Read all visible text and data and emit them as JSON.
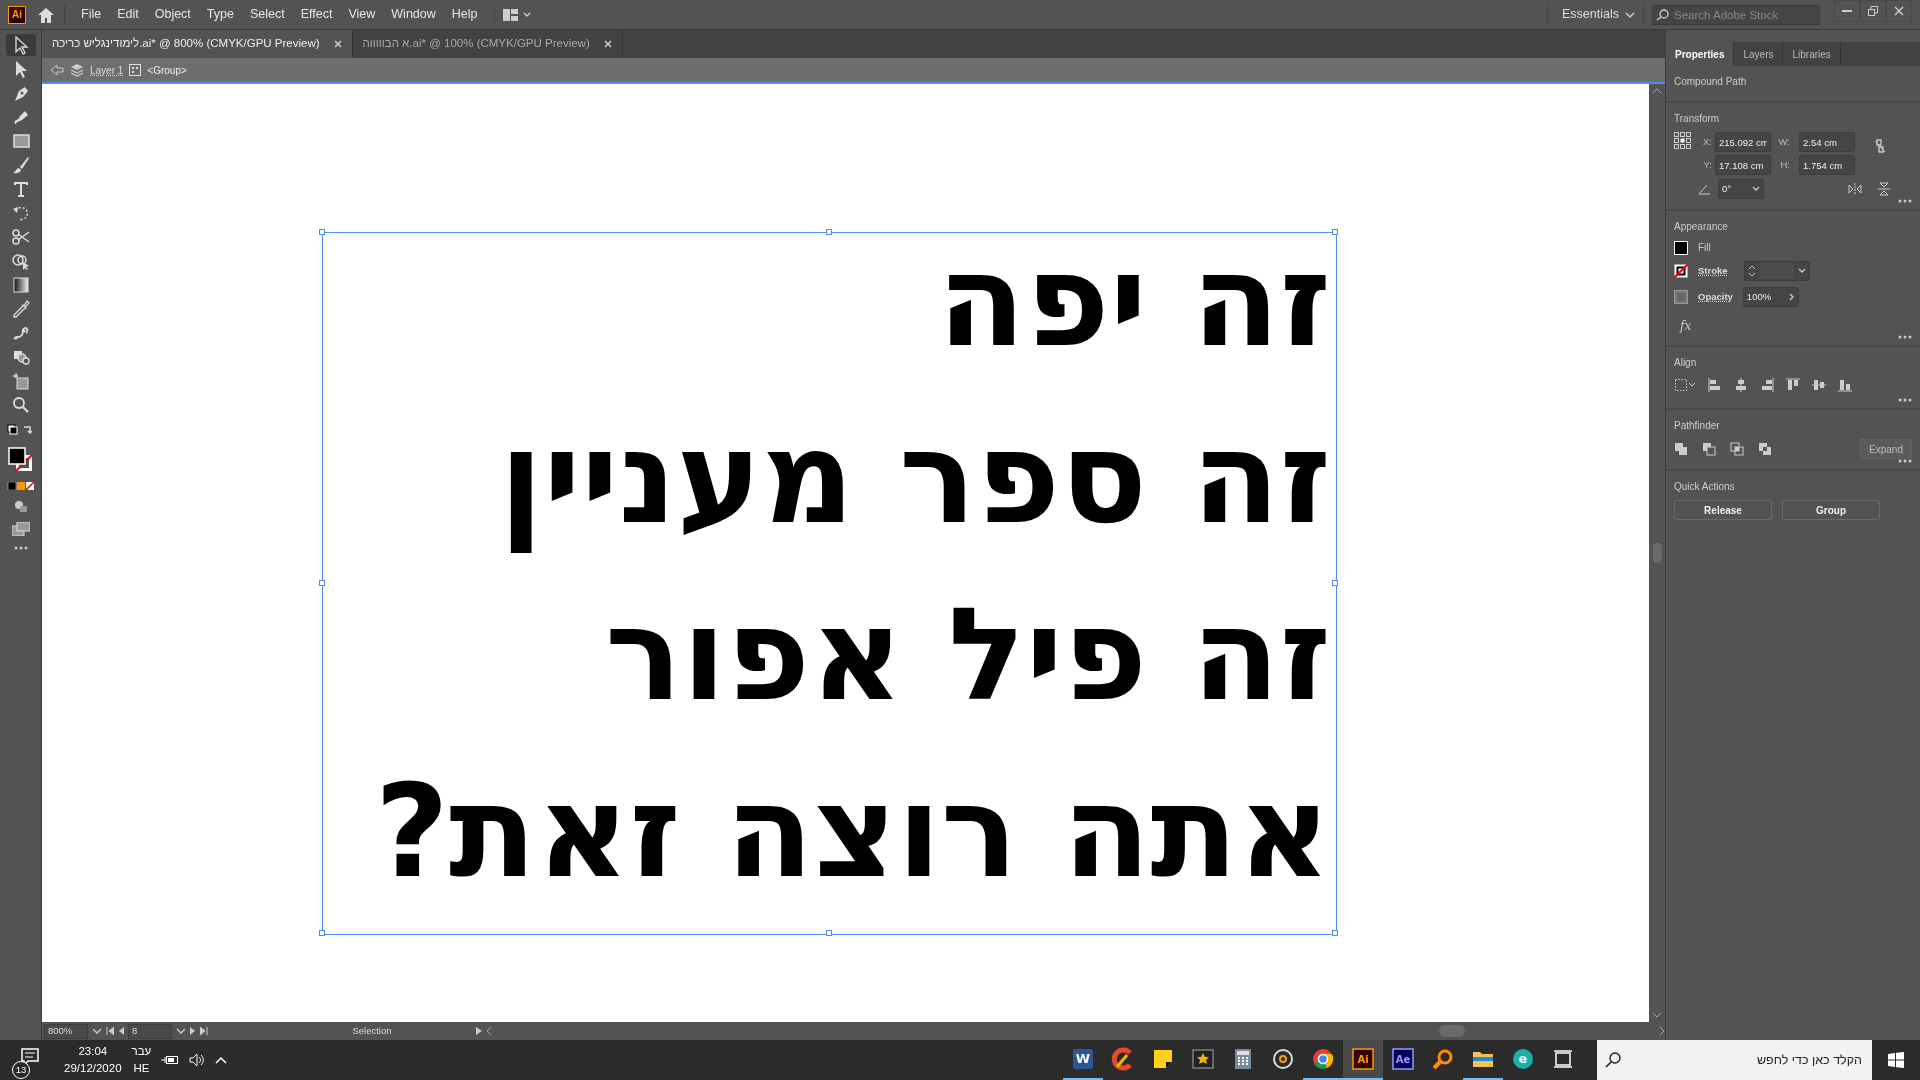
{
  "app": {
    "logo": "Ai"
  },
  "menu": [
    {
      "label": "File"
    },
    {
      "label": "Edit"
    },
    {
      "label": "Object"
    },
    {
      "label": "Type"
    },
    {
      "label": "Select"
    },
    {
      "label": "Effect"
    },
    {
      "label": "View"
    },
    {
      "label": "Window"
    },
    {
      "label": "Help"
    }
  ],
  "workspace": "Essentials",
  "stock_search": {
    "placeholder": "Search Adobe Stock"
  },
  "documents": [
    {
      "title": "לימודינגליש כריכה.ai* @ 800% (CMYK/GPU Preview)",
      "selected": true
    },
    {
      "title": "א הבוווווה.ai* @ 100% (CMYK/GPU Preview)",
      "selected": false
    }
  ],
  "breadcrumb": {
    "layer": "Layer 1",
    "group": "<Group>"
  },
  "tools": [
    {
      "kind": "selection",
      "selected": true
    },
    {
      "kind": "direct-selection",
      "selected": false
    },
    {
      "kind": "pen",
      "selected": false
    },
    {
      "kind": "curvature",
      "selected": false
    },
    {
      "kind": "rectangle",
      "selected": false
    },
    {
      "kind": "brush",
      "selected": false
    },
    {
      "kind": "type",
      "selected": false
    },
    {
      "kind": "rotate",
      "selected": false
    },
    {
      "kind": "scissors",
      "selected": false
    },
    {
      "kind": "shape-builder",
      "selected": false
    },
    {
      "kind": "gradient",
      "selected": false
    },
    {
      "kind": "eyedropper",
      "selected": false
    },
    {
      "kind": "puppet-warp",
      "selected": false
    },
    {
      "kind": "symbol",
      "selected": false
    },
    {
      "kind": "artboard",
      "selected": false
    },
    {
      "kind": "zoom",
      "selected": false
    }
  ],
  "artboard": {
    "lines": [
      "זה יפה",
      "זה ספר מעניין",
      "זה פיל אפור",
      "אתה רוצה זאת?"
    ]
  },
  "status_bar": {
    "zoom": "800%",
    "artboard": "8",
    "tool": "Selection"
  },
  "panel": {
    "tabs": [
      {
        "label": "Properties",
        "selected": true
      },
      {
        "label": "Layers",
        "selected": false
      },
      {
        "label": "Libraries",
        "selected": false
      }
    ],
    "object_type": "Compound Path",
    "transform": {
      "title": "Transform",
      "fields": [
        {
          "label": "X:",
          "value": "215.092 cm"
        },
        {
          "label": "W:",
          "value": "2.54 cm"
        },
        {
          "label": "Y:",
          "value": "17.108 cm"
        },
        {
          "label": "H:",
          "value": "1.754 cm"
        }
      ],
      "angle": "0°"
    },
    "appearance": {
      "title": "Appearance",
      "fill": "Fill",
      "stroke": "Stroke",
      "opacity_label": "Opacity",
      "opacity": "100%",
      "fx": "fx"
    },
    "align": {
      "title": "Align"
    },
    "pathfinder": {
      "title": "Pathfinder",
      "expand": {
        "label": "Expand",
        "disabled": true
      }
    },
    "quick_actions": {
      "title": "Quick Actions",
      "buttons": [
        "Release",
        "Group"
      ]
    }
  },
  "taskbar": {
    "notifications": "13",
    "time": "23:04",
    "date": "29/12/2020",
    "language": "עבר",
    "layout": "HE",
    "search": {
      "placeholder": "הקלד כאן כדי לחפש"
    },
    "apps": [
      {
        "kind": "word",
        "label": "W",
        "running": true,
        "selected": false
      },
      {
        "kind": "cleaner",
        "running": false,
        "selected": false
      },
      {
        "kind": "notes",
        "running": false,
        "selected": false
      },
      {
        "kind": "movie",
        "running": false,
        "selected": false
      },
      {
        "kind": "calculator",
        "running": false,
        "selected": false
      },
      {
        "kind": "disc",
        "running": false,
        "selected": false
      },
      {
        "kind": "browser",
        "running": true,
        "selected": false
      },
      {
        "kind": "illustrator",
        "label": "Ai",
        "running": true,
        "selected": true
      },
      {
        "kind": "after-effects",
        "label": "Ae",
        "running": false,
        "selected": false
      },
      {
        "kind": "magnifier",
        "running": false,
        "selected": false
      },
      {
        "kind": "folder",
        "running": true,
        "selected": false
      },
      {
        "kind": "edge",
        "label": "e",
        "running": false,
        "selected": false
      },
      {
        "kind": "task-view",
        "running": false,
        "selected": false
      }
    ]
  }
}
